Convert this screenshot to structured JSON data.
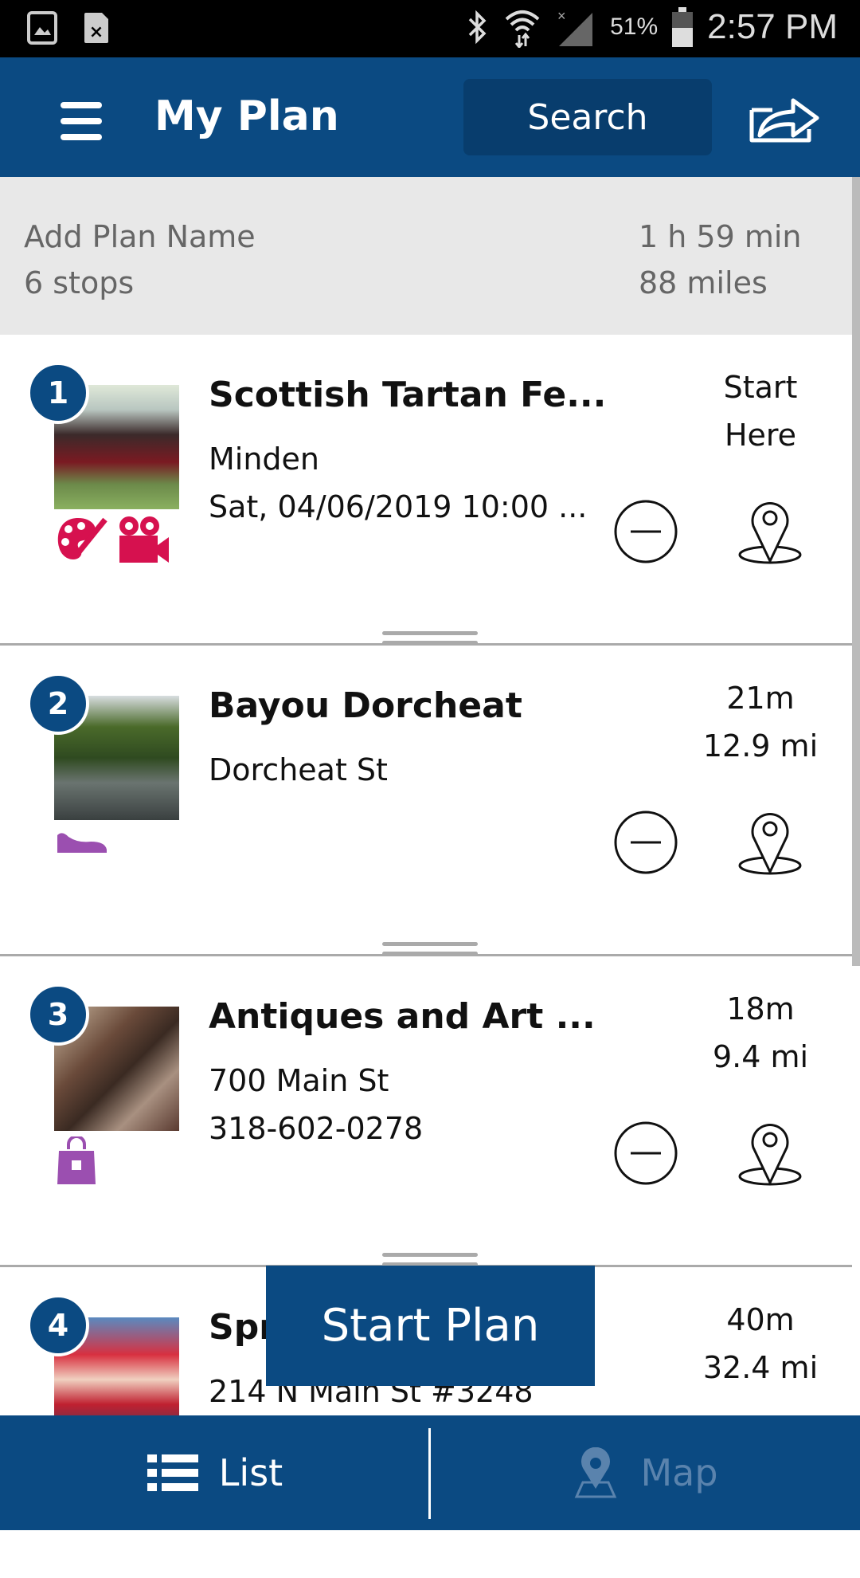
{
  "status_bar": {
    "battery": "51%",
    "time": "2:57 PM",
    "icons": [
      "image-icon",
      "sim-error-icon",
      "bluetooth-icon",
      "wifi-icon",
      "signal-icon",
      "battery-icon"
    ]
  },
  "header": {
    "title": "My Plan",
    "search_label": "Search",
    "icons": [
      "menu-icon",
      "share-icon"
    ]
  },
  "summary": {
    "plan_name_placeholder": "Add Plan Name",
    "stops": "6 stops",
    "duration": "1 h 59 min",
    "distance": "88 miles"
  },
  "stops": [
    {
      "number": "1",
      "name": "Scottish Tartan Fe...",
      "line1": "Minden",
      "line2": "Sat, 04/06/2019 10:00 ...",
      "eta1": "Start",
      "eta2": "Here",
      "categories": [
        "arts-palette-icon",
        "film-camera-icon"
      ],
      "category_color": "#d6114f"
    },
    {
      "number": "2",
      "name": "Bayou Dorcheat",
      "line1": "Dorcheat St",
      "line2": "",
      "eta1": "21m",
      "eta2": "12.9 mi",
      "categories": [
        "shoe-icon"
      ],
      "category_color": "#9b4fb0"
    },
    {
      "number": "3",
      "name": "Antiques and Art ...",
      "line1": "700 Main St",
      "line2": "318-602-0278",
      "eta1": "18m",
      "eta2": "9.4 mi",
      "categories": [
        "shopping-bag-icon"
      ],
      "category_color": "#9b4fb0"
    },
    {
      "number": "4",
      "name": "Spr",
      "line1": "214 N Main St #3248",
      "line2": "",
      "eta1": "40m",
      "eta2": "32.4 mi",
      "categories": []
    }
  ],
  "start_plan_label": "Start Plan",
  "bottom_nav": {
    "list_label": "List",
    "map_label": "Map"
  },
  "colors": {
    "brand": "#0b4a82",
    "summary_bg": "#e8e8e8"
  }
}
